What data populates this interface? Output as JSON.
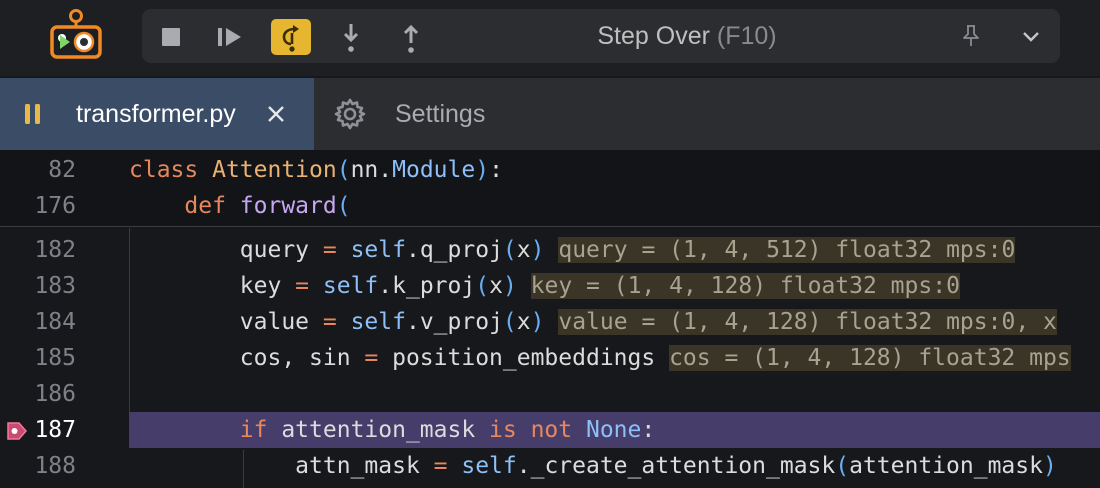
{
  "toolbar": {
    "step_label": "Step Over",
    "step_shortcut": "(F10)",
    "buttons": [
      {
        "name": "stop-button",
        "icon": "stop-icon"
      },
      {
        "name": "continue-button",
        "icon": "play-pause-icon"
      },
      {
        "name": "step-over-button",
        "icon": "step-over-icon",
        "active": true
      },
      {
        "name": "step-into-button",
        "icon": "arrow-down-icon"
      },
      {
        "name": "step-out-button",
        "icon": "arrow-up-icon"
      }
    ],
    "accent_color": "#e6b630"
  },
  "tabs": {
    "active_title": "transformer.py",
    "settings_label": "Settings"
  },
  "editor": {
    "sticky": [
      {
        "num": "82",
        "segments": [
          [
            "kw",
            "class "
          ],
          [
            "cls",
            "Attention"
          ],
          [
            "paren",
            "("
          ],
          [
            "",
            "nn."
          ],
          [
            "slf",
            "Module"
          ],
          [
            "paren",
            ")"
          ],
          [
            "",
            ":"
          ]
        ]
      },
      {
        "num": "176",
        "segments": [
          [
            "",
            "    "
          ],
          [
            "kw",
            "def "
          ],
          [
            "fn",
            "forward"
          ],
          [
            "paren",
            "("
          ]
        ]
      }
    ],
    "lines": [
      {
        "num": "182",
        "segments": [
          [
            "",
            "        query "
          ],
          [
            "op",
            "="
          ],
          [
            "slf",
            " self"
          ],
          [
            "",
            ".q_proj"
          ],
          [
            "paren",
            "("
          ],
          [
            "",
            "x"
          ],
          [
            "paren",
            ")"
          ],
          [
            "inl_sp",
            " "
          ],
          [
            "inl",
            "query = (1, 4, 512) float32 mps:0"
          ]
        ]
      },
      {
        "num": "183",
        "segments": [
          [
            "",
            "        key "
          ],
          [
            "op",
            "="
          ],
          [
            "slf",
            " self"
          ],
          [
            "",
            ".k_proj"
          ],
          [
            "paren",
            "("
          ],
          [
            "",
            "x"
          ],
          [
            "paren",
            ")"
          ],
          [
            "inl_sp",
            " "
          ],
          [
            "inl",
            "key = (1, 4, 128) float32 mps:0"
          ]
        ]
      },
      {
        "num": "184",
        "segments": [
          [
            "",
            "        value "
          ],
          [
            "op",
            "="
          ],
          [
            "slf",
            " self"
          ],
          [
            "",
            ".v_proj"
          ],
          [
            "paren",
            "("
          ],
          [
            "",
            "x"
          ],
          [
            "paren",
            ")"
          ],
          [
            "inl_sp",
            " "
          ],
          [
            "inl",
            "value = (1, 4, 128) float32 mps:0, x"
          ]
        ]
      },
      {
        "num": "185",
        "segments": [
          [
            "",
            "        cos, sin "
          ],
          [
            "op",
            "="
          ],
          [
            "",
            " position_embeddings"
          ],
          [
            "inl_sp",
            " "
          ],
          [
            "inl",
            "cos = (1, 4, 128) float32 mps"
          ]
        ]
      },
      {
        "num": "186",
        "segments": []
      },
      {
        "num": "187",
        "current": true,
        "segments": [
          [
            "",
            "        "
          ],
          [
            "kw",
            "if"
          ],
          [
            "",
            " attention_mask "
          ],
          [
            "kw",
            "is not"
          ],
          [
            "bi",
            " None"
          ],
          [
            "",
            ":"
          ]
        ]
      },
      {
        "num": "188",
        "segments": [
          [
            "",
            "            attn_mask "
          ],
          [
            "op",
            "="
          ],
          [
            "slf",
            " self"
          ],
          [
            "",
            "._create_attention_mask"
          ],
          [
            "paren",
            "("
          ],
          [
            "",
            "attention_mask"
          ],
          [
            "paren",
            ")"
          ]
        ]
      }
    ]
  }
}
